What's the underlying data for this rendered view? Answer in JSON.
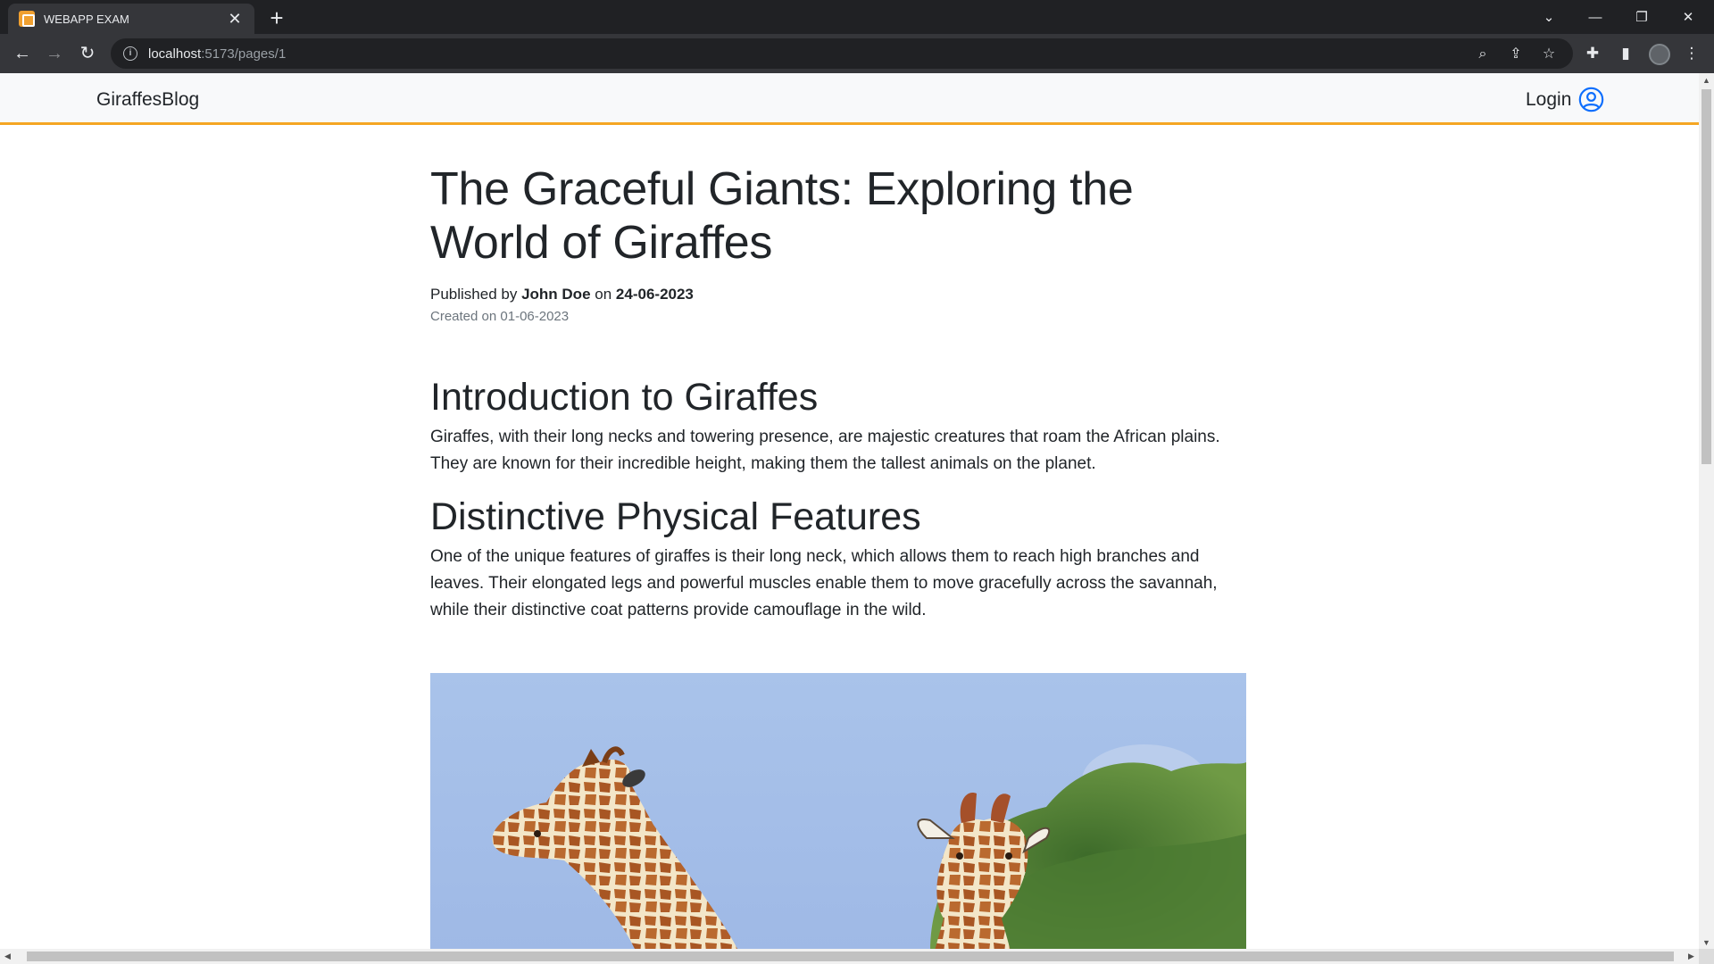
{
  "browser": {
    "tab_title": "WEBAPP EXAM",
    "url_host": "localhost",
    "url_path": ":5173/pages/1"
  },
  "navbar": {
    "brand": "GiraffesBlog",
    "login_label": "Login"
  },
  "article": {
    "title": "The Graceful Giants: Exploring the World of Giraffes",
    "published_prefix": "Published by",
    "author": "John Doe",
    "published_on_word": "on",
    "published_date": "24-06-2023",
    "created": "Created on 01-06-2023",
    "sections": [
      {
        "heading": "Introduction to Giraffes",
        "body": "Giraffes, with their long necks and towering presence, are majestic creatures that roam the African plains. They are known for their incredible height, making them the tallest animals on the planet."
      },
      {
        "heading": "Distinctive Physical Features",
        "body": "One of the unique features of giraffes is their long neck, which allows them to reach high branches and leaves. Their elongated legs and powerful muscles enable them to move gracefully across the savannah, while their distinctive coat patterns provide camouflage in the wild."
      }
    ]
  },
  "colors": {
    "navbar_accent": "#f5a623",
    "login_icon": "#0d6efd"
  }
}
